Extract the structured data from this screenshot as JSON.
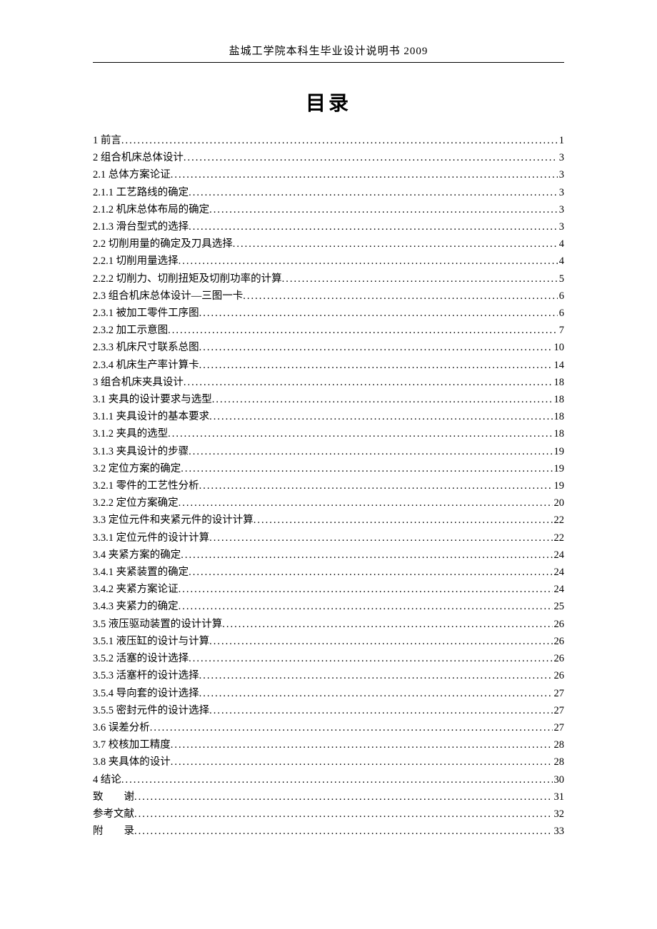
{
  "header": "盐城工学院本科生毕业设计说明书 2009",
  "title": "目录",
  "toc": [
    {
      "label": "1 前言",
      "page": "1"
    },
    {
      "label": "2 组合机床总体设计",
      "page": "3"
    },
    {
      "label": "2.1 总体方案论证",
      "page": "3"
    },
    {
      "label": "2.1.1 工艺路线的确定",
      "page": "3"
    },
    {
      "label": "2.1.2 机床总体布局的确定",
      "page": "3"
    },
    {
      "label": "2.1.3 滑台型式的选择",
      "page": "3"
    },
    {
      "label": "2.2 切削用量的确定及刀具选择",
      "page": "4"
    },
    {
      "label": "2.2.1 切削用量选择",
      "page": "4"
    },
    {
      "label": "2.2.2 切削力、切削扭矩及切削功率的计算",
      "page": "5"
    },
    {
      "label": "2.3 组合机床总体设计—三图一卡",
      "page": "6"
    },
    {
      "label": "2.3.1 被加工零件工序图",
      "page": "6"
    },
    {
      "label": "2.3.2 加工示意图",
      "page": "7"
    },
    {
      "label": "2.3.3 机床尺寸联系总图",
      "page": "10"
    },
    {
      "label": "2.3.4 机床生产率计算卡",
      "page": "14"
    },
    {
      "label": "3 组合机床夹具设计",
      "page": "18"
    },
    {
      "label": "3.1 夹具的设计要求与选型",
      "page": "18"
    },
    {
      "label": "3.1.1 夹具设计的基本要求",
      "page": "18"
    },
    {
      "label": "3.1.2 夹具的选型",
      "page": "18"
    },
    {
      "label": "3.1.3 夹具设计的步骤",
      "page": "19"
    },
    {
      "label": "3.2 定位方案的确定",
      "page": "19"
    },
    {
      "label": "3.2.1 零件的工艺性分析",
      "page": "19"
    },
    {
      "label": "3.2.2 定位方案确定",
      "page": "20"
    },
    {
      "label": "3.3 定位元件和夹紧元件的设计计算",
      "page": "22"
    },
    {
      "label": "3.3.1 定位元件的设计计算",
      "page": "22"
    },
    {
      "label": "3.4 夹紧方案的确定",
      "page": "24"
    },
    {
      "label": "3.4.1 夹紧装置的确定",
      "page": "24"
    },
    {
      "label": "3.4.2 夹紧方案论证",
      "page": "24"
    },
    {
      "label": "3.4.3 夹紧力的确定",
      "page": "25"
    },
    {
      "label": "3.5 液压驱动装置的设计计算",
      "page": "26"
    },
    {
      "label": "3.5.1 液压缸的设计与计算",
      "page": "26"
    },
    {
      "label": "3.5.2 活塞的设计选择",
      "page": "26"
    },
    {
      "label": "3.5.3 活塞杆的设计选择",
      "page": "26"
    },
    {
      "label": "3.5.4 导向套的设计选择",
      "page": "27"
    },
    {
      "label": "3.5.5 密封元件的设计选择",
      "page": "27"
    },
    {
      "label": "3.6 误差分析",
      "page": "27"
    },
    {
      "label": "3.7 校核加工精度",
      "page": "28"
    },
    {
      "label": "3.8 夹具体的设计",
      "page": "28"
    },
    {
      "label": "4 结论",
      "page": "30"
    },
    {
      "label": "致　　谢",
      "page": "31"
    },
    {
      "label": "参考文献",
      "page": "32"
    },
    {
      "label": "附　　录",
      "page": "33"
    }
  ]
}
